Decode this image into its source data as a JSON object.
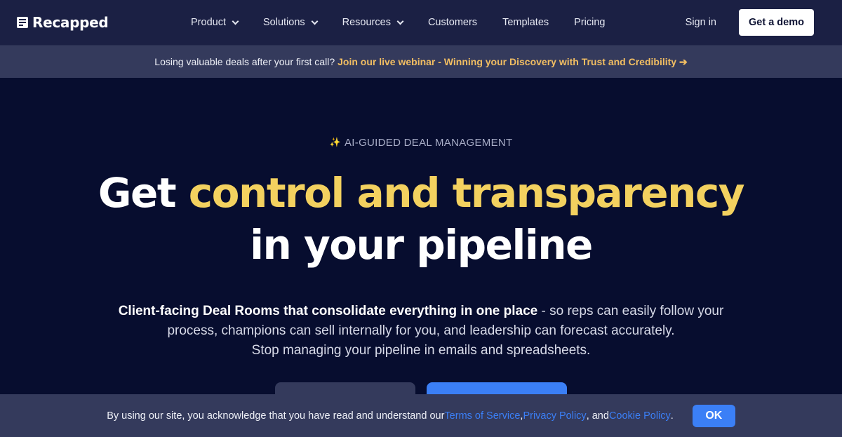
{
  "nav": {
    "brand": "Recapped",
    "brand_icon": "document-lines-icon",
    "menu": [
      {
        "label": "Product",
        "has_dropdown": true
      },
      {
        "label": "Solutions",
        "has_dropdown": true
      },
      {
        "label": "Resources",
        "has_dropdown": true
      },
      {
        "label": "Customers",
        "has_dropdown": false
      },
      {
        "label": "Templates",
        "has_dropdown": false
      },
      {
        "label": "Pricing",
        "has_dropdown": false
      }
    ],
    "sign_in": "Sign in",
    "cta": "Get a demo"
  },
  "announcement": {
    "text": "Losing valuable deals after your first call?",
    "link": "Join our live webinar - Winning your Discovery with Trust and Credibility ➔",
    "link_color": "#f2be62"
  },
  "hero": {
    "eyebrow_icon": "✨",
    "eyebrow": "AI-GUIDED DEAL MANAGEMENT",
    "headline_part1": "Get ",
    "headline_highlight": "control and transparency",
    "headline_part2": "in your pipeline",
    "highlight_color": "#f3d15f",
    "sub_bold": "Client-facing Deal Rooms that consolidate everything in one place",
    "sub_rest1": " - so reps can easily follow your",
    "sub_line2": "process, champions can sell internally for you, and leadership can forecast accurately.",
    "sub_line3": "Stop managing your pipeline in emails and spreadsheets."
  },
  "cookie": {
    "text": "By using our site, you acknowledge that you have read and understand our ",
    "terms": "Terms of Service",
    "sep1": ", ",
    "privacy": "Privacy Policy",
    "sep2": ", and ",
    "cookie_policy": "Cookie Policy",
    "end": ".",
    "ok": "OK"
  },
  "colors": {
    "nav_bg": "#1b2044",
    "banner_bg": "#343a5c",
    "hero_bg": "#070d2f",
    "accent_blue": "#3b7ff6"
  }
}
